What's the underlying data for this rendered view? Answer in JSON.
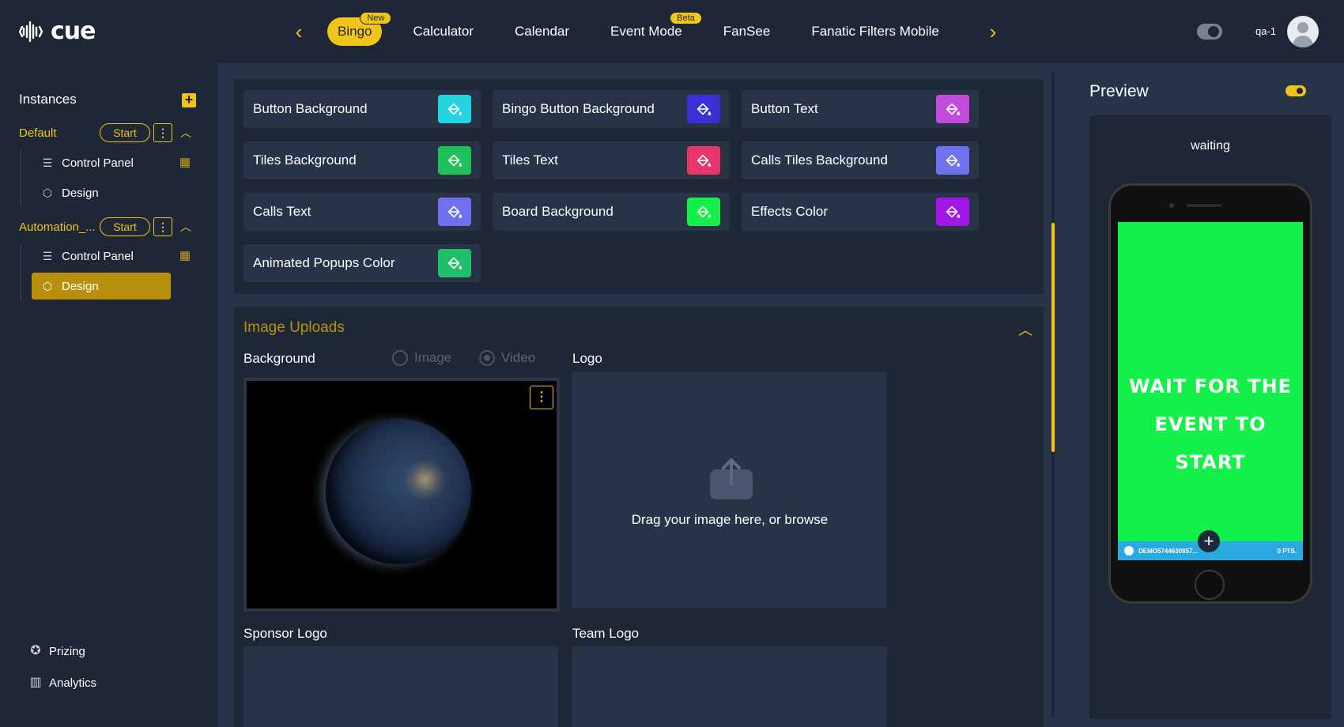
{
  "brand": {
    "logo_text": "cue"
  },
  "nav": {
    "prev_icon": "chevron-left-icon",
    "next_icon": "chevron-right-icon",
    "tabs": [
      {
        "label": "Bingo",
        "badge": "New",
        "active": true
      },
      {
        "label": "Calculator",
        "badge": "",
        "active": false
      },
      {
        "label": "Calendar",
        "badge": "",
        "active": false
      },
      {
        "label": "Event Mode",
        "badge": "Beta",
        "active": false
      },
      {
        "label": "FanSee",
        "badge": "",
        "active": false
      },
      {
        "label": "Fanatic Filters Mobile",
        "badge": "",
        "active": false
      }
    ]
  },
  "user": {
    "name": "qa-1"
  },
  "sidebar": {
    "title": "Instances",
    "instances": [
      {
        "name": "Default",
        "start_label": "Start",
        "items": [
          {
            "label": "Control Panel"
          },
          {
            "label": "Design"
          }
        ]
      },
      {
        "name": "Automation_...",
        "start_label": "Start",
        "items": [
          {
            "label": "Control Panel"
          },
          {
            "label": "Design",
            "active": true
          }
        ]
      }
    ],
    "bottom_links": [
      {
        "label": "Prizing",
        "icon": "award-icon"
      },
      {
        "label": "Analytics",
        "icon": "bar-chart-icon"
      }
    ]
  },
  "colors": {
    "items": [
      {
        "label": "Button Background",
        "color": "#22d3e0"
      },
      {
        "label": "Bingo Button Background",
        "color": "#3b2fd6"
      },
      {
        "label": "Button Text",
        "color": "#c24bdc"
      },
      {
        "label": "Tiles Background",
        "color": "#1fbf5a"
      },
      {
        "label": "Tiles Text",
        "color": "#e8366b"
      },
      {
        "label": "Calls Tiles Background",
        "color": "#7071ef"
      },
      {
        "label": "Calls Text",
        "color": "#7071ef"
      },
      {
        "label": "Board Background",
        "color": "#14f04a"
      },
      {
        "label": "Effects Color",
        "color": "#a216e8"
      },
      {
        "label": "Animated Popups Color",
        "color": "#1fbf6a"
      }
    ]
  },
  "uploads": {
    "title": "Image Uploads",
    "background_label": "Background",
    "radio_image": "Image",
    "radio_video": "Video",
    "logo_label": "Logo",
    "drop_text": "Drag your image here, or browse",
    "sponsor_label": "Sponsor Logo",
    "team_label": "Team Logo"
  },
  "preview": {
    "title": "Preview",
    "status": "waiting",
    "message_line1": "WAIT FOR THE",
    "message_line2": "EVENT TO START",
    "player_id": "DEMO5744630957...",
    "points": "0 PTS."
  },
  "accent_color": "#f0c419"
}
